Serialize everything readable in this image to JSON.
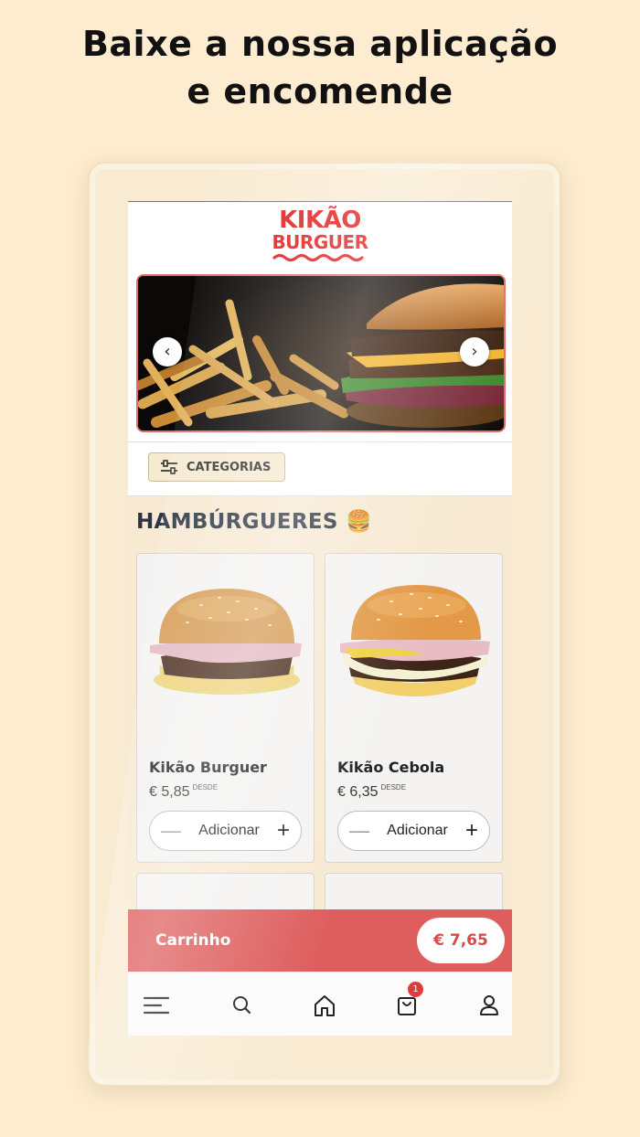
{
  "headline": {
    "line1": "Baixe a nossa aplicação",
    "line2": "e encomende"
  },
  "brand": {
    "line1": "KIKÃO",
    "line2": "BURGUER",
    "color": "#e01e1e"
  },
  "banner": {
    "prev_icon": "chevron-left-icon",
    "next_icon": "chevron-right-icon"
  },
  "categories_button": {
    "label": "CATEGORIAS",
    "icon": "sliders-icon"
  },
  "section": {
    "title": "HAMBÚRGUERES 🍔"
  },
  "products": [
    {
      "name": "Kikão Burguer",
      "price": "€ 5,85",
      "price_note": "DESDE",
      "add_label": "Adicionar"
    },
    {
      "name": "Kikão Cebola",
      "price": "€ 6,35",
      "price_note": "DESDE",
      "add_label": "Adicionar"
    }
  ],
  "cart": {
    "label": "Carrinho",
    "total": "€ 7,65",
    "color": "#de5d5d"
  },
  "nav": {
    "items": [
      "menu-icon",
      "search-icon",
      "home-icon",
      "bag-icon",
      "user-icon"
    ],
    "bag_badge": "1"
  }
}
